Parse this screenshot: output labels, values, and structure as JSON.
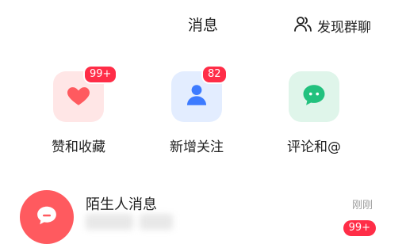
{
  "header": {
    "title": "消息",
    "discover_label": "发现群聊"
  },
  "categories": [
    {
      "label": "赞和收藏",
      "badge": "99+",
      "icon": "heart-icon",
      "color": "#ff5a5f"
    },
    {
      "label": "新增关注",
      "badge": "82",
      "icon": "person-icon",
      "color": "#3d7bff"
    },
    {
      "label": "评论和@",
      "badge": "",
      "icon": "chat-bubble-icon",
      "color": "#22c17e"
    }
  ],
  "messages": [
    {
      "title": "陌生人消息",
      "time": "刚刚",
      "badge": "99+",
      "icon": "chat-bubble-icon"
    }
  ],
  "colors": {
    "accent": "#ff2d47",
    "avatar": "#ff5a5f"
  }
}
